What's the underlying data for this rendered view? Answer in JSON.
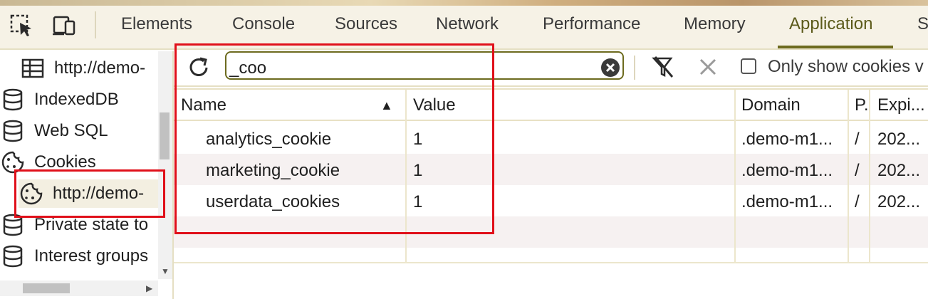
{
  "toolbar": {
    "tabs": [
      "Elements",
      "Console",
      "Sources",
      "Network",
      "Performance",
      "Memory",
      "Application",
      "S"
    ],
    "active_tab": "Application",
    "accent": "#6d6b1f"
  },
  "sidebar": {
    "items": [
      {
        "label": "http://demo-",
        "icon": "table-icon"
      },
      {
        "label": "IndexedDB",
        "icon": "database-icon"
      },
      {
        "label": "Web SQL",
        "icon": "database-icon"
      },
      {
        "label": "Cookies",
        "icon": "cookie-icon"
      },
      {
        "label": "http://demo-",
        "icon": "cookie-icon"
      },
      {
        "label": "Private state to",
        "icon": "database-icon"
      },
      {
        "label": "Interest groups",
        "icon": "database-icon"
      }
    ]
  },
  "cookies": {
    "filter_value": "_coo",
    "only_show_label": "Only show cookies v",
    "columns": [
      "Name",
      "Value",
      "Domain",
      "P.",
      "Expi..."
    ],
    "rows": [
      {
        "name": "analytics_cookie",
        "value": "1",
        "domain": ".demo-m1...",
        "path": "/",
        "expires": "202..."
      },
      {
        "name": "marketing_cookie",
        "value": "1",
        "domain": ".demo-m1...",
        "path": "/",
        "expires": "202..."
      },
      {
        "name": "userdata_cookies",
        "value": "1",
        "domain": ".demo-m1...",
        "path": "/",
        "expires": "202..."
      }
    ]
  },
  "highlight_color": "#e0101a"
}
